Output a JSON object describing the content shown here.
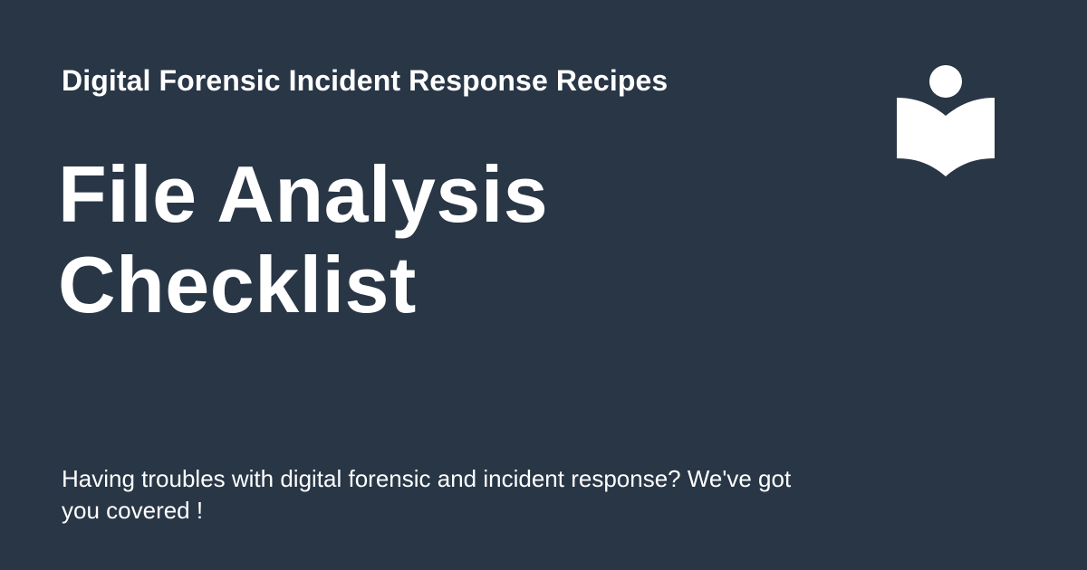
{
  "site": {
    "title": "Digital Forensic Incident Response Recipes"
  },
  "page": {
    "title_lines": [
      "File Analysis",
      "Checklist"
    ],
    "description": "Having troubles with digital forensic and incident response? We've got you covered !"
  },
  "colors": {
    "background": "#283646",
    "foreground": "#ffffff"
  },
  "icons": {
    "logo": "reader-book-icon"
  }
}
